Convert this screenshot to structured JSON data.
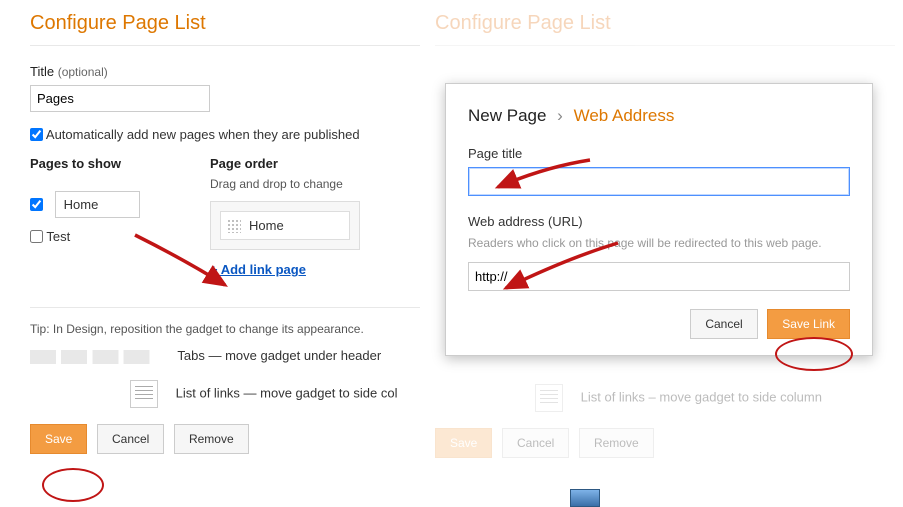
{
  "left": {
    "heading": "Configure Page List",
    "title_label": "Title",
    "title_optional": "(optional)",
    "title_value": "Pages",
    "auto_add_label": "Automatically add new pages when they are published",
    "auto_add_checked": true,
    "pages_to_show_label": "Pages to show",
    "pages": [
      {
        "label": "Home",
        "checked": true
      },
      {
        "label": "Test",
        "checked": false
      }
    ],
    "page_order_label": "Page order",
    "page_order_hint": "Drag and drop to change",
    "order_items": [
      "Home"
    ],
    "add_link_text": "+ Add link page",
    "tip": "Tip: In Design, reposition the gadget to change its appearance.",
    "tabs_hint": "Tabs — move gadget under header",
    "list_hint": "List of links — move gadget to side col",
    "buttons": {
      "save": "Save",
      "cancel": "Cancel",
      "remove": "Remove"
    }
  },
  "right": {
    "heading": "Configure Page List",
    "list_hint": "List of links – move gadget to side column",
    "buttons": {
      "save": "Save",
      "cancel": "Cancel",
      "remove": "Remove"
    }
  },
  "modal": {
    "crumb_root": "New Page",
    "crumb_sep": "›",
    "crumb_leaf": "Web Address",
    "page_title_label": "Page title",
    "page_title_value": "",
    "url_label": "Web address (URL)",
    "url_hint": "Readers who click on this page will be redirected to this web page.",
    "url_value": "http://",
    "buttons": {
      "cancel": "Cancel",
      "save": "Save Link"
    }
  }
}
